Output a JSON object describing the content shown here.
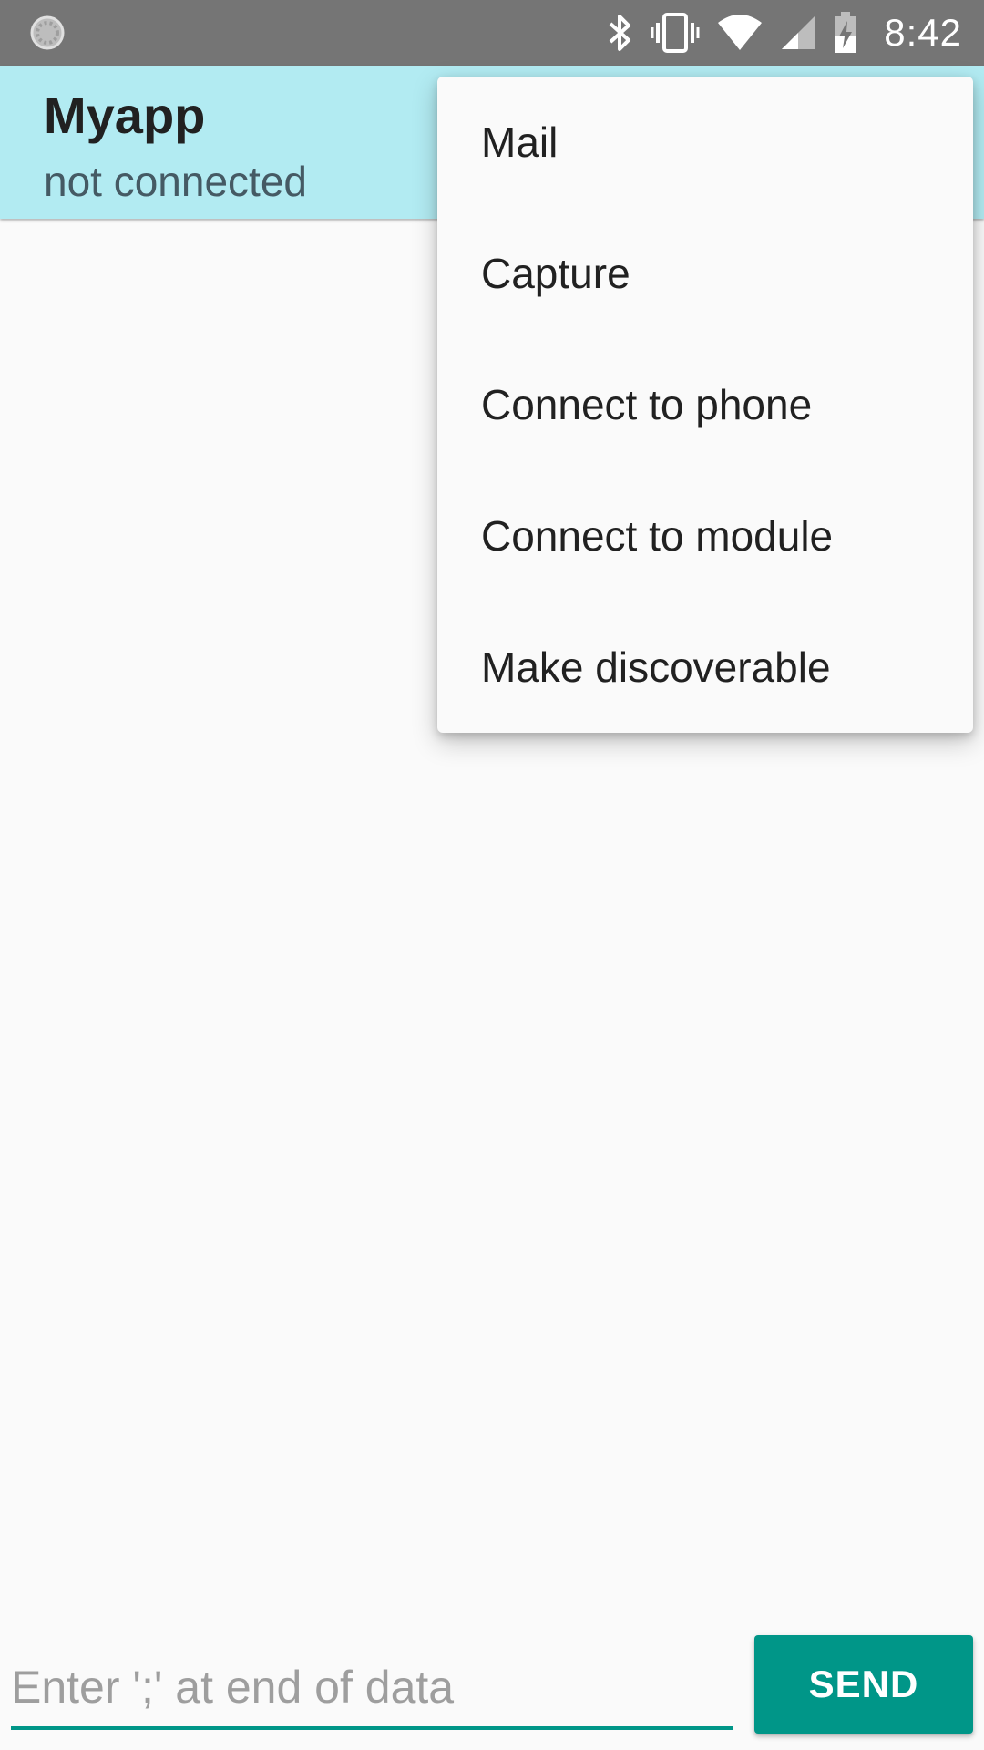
{
  "status_bar": {
    "time": "8:42",
    "icons": [
      "loading-spinner-icon",
      "bluetooth-icon",
      "vibrate-icon",
      "wifi-icon",
      "cell-signal-icon",
      "battery-charging-icon"
    ],
    "background_color": "#757575"
  },
  "app_bar": {
    "title": "Myapp",
    "subtitle": "not connected",
    "background_color": "#b2ebf2"
  },
  "menu": {
    "items": [
      {
        "label": "Mail"
      },
      {
        "label": "Capture"
      },
      {
        "label": "Connect to phone"
      },
      {
        "label": "Connect to module"
      },
      {
        "label": "Make discoverable"
      }
    ]
  },
  "input_bar": {
    "input_value": "",
    "placeholder": "Enter ';' at end of data",
    "send_label": "SEND",
    "accent_color": "#009688"
  }
}
